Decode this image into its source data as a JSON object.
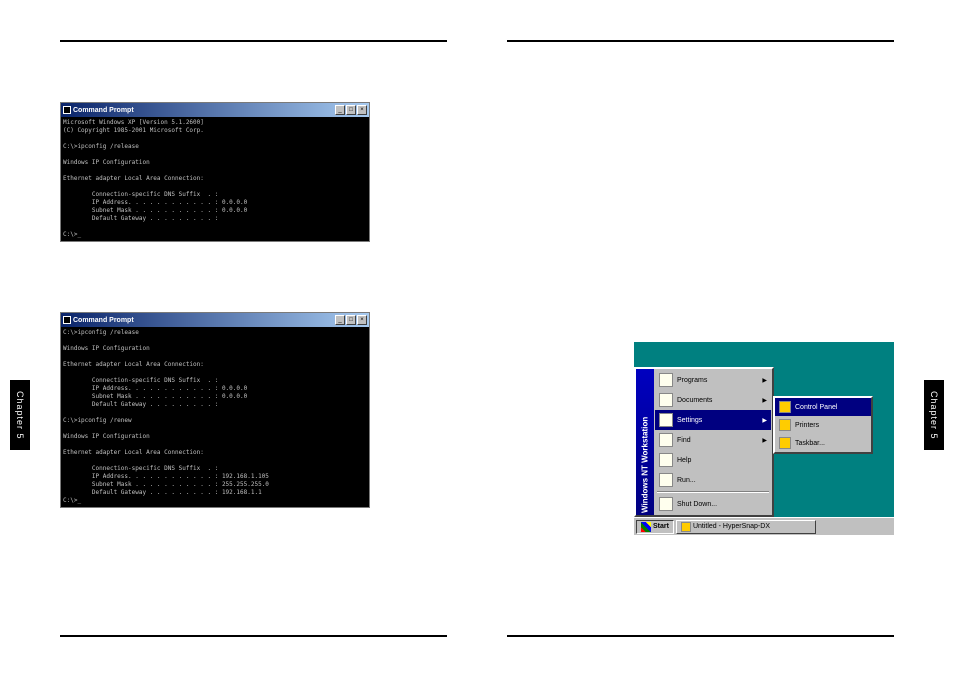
{
  "sideTab": "Chapter 5",
  "cmdWindow1": {
    "title": "Command Prompt",
    "lines": [
      "Microsoft Windows XP [Version 5.1.2600]",
      "(C) Copyright 1985-2001 Microsoft Corp.",
      "",
      "C:\\>ipconfig /release",
      "",
      "Windows IP Configuration",
      "",
      "Ethernet adapter Local Area Connection:",
      "",
      "        Connection-specific DNS Suffix  . :",
      "        IP Address. . . . . . . . . . . . : 0.0.0.0",
      "        Subnet Mask . . . . . . . . . . . : 0.0.0.0",
      "        Default Gateway . . . . . . . . . :",
      "",
      "C:\\>_"
    ]
  },
  "cmdWindow2": {
    "title": "Command Prompt",
    "lines": [
      "C:\\>ipconfig /release",
      "",
      "Windows IP Configuration",
      "",
      "Ethernet adapter Local Area Connection:",
      "",
      "        Connection-specific DNS Suffix  . :",
      "        IP Address. . . . . . . . . . . . : 0.0.0.0",
      "        Subnet Mask . . . . . . . . . . . : 0.0.0.0",
      "        Default Gateway . . . . . . . . . :",
      "",
      "C:\\>ipconfig /renew",
      "",
      "Windows IP Configuration",
      "",
      "Ethernet adapter Local Area Connection:",
      "",
      "        Connection-specific DNS Suffix  . :",
      "        IP Address. . . . . . . . . . . . : 192.168.1.105",
      "        Subnet Mask . . . . . . . . . . . : 255.255.255.0",
      "        Default Gateway . . . . . . . . . : 192.168.1.1",
      "C:\\>_"
    ]
  },
  "ntMenu": {
    "banner": "Windows NT Workstation",
    "items": [
      {
        "label": "Programs",
        "arrow": true
      },
      {
        "label": "Documents",
        "arrow": true
      },
      {
        "label": "Settings",
        "arrow": true,
        "highlighted": true
      },
      {
        "label": "Find",
        "arrow": true
      },
      {
        "label": "Help",
        "arrow": false
      },
      {
        "label": "Run...",
        "arrow": false
      }
    ],
    "shutdown": "Shut Down...",
    "submenu": [
      {
        "label": "Control Panel",
        "highlighted": true
      },
      {
        "label": "Printers",
        "highlighted": false
      },
      {
        "label": "Taskbar...",
        "highlighted": false
      }
    ],
    "startButton": "Start",
    "taskButton": "Untitled - HyperSnap-DX"
  }
}
